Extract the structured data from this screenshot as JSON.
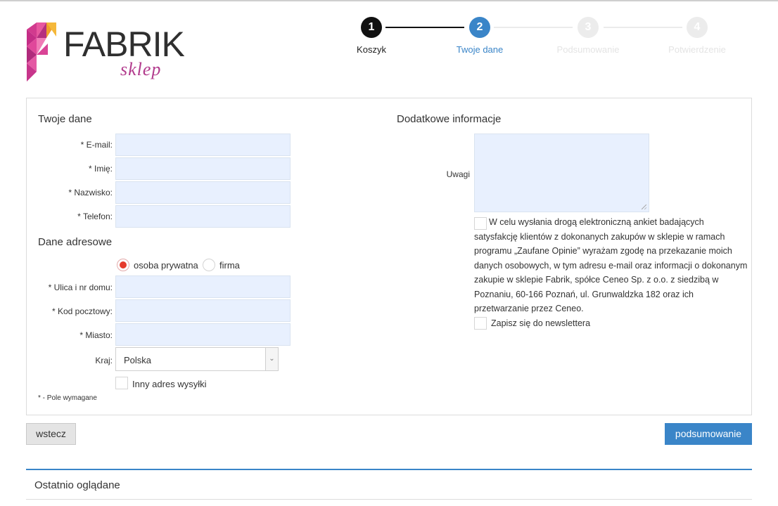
{
  "logo": {
    "brand": "FABRIK",
    "subtitle": "sklep"
  },
  "steps": [
    {
      "number": "1",
      "label": "Koszyk"
    },
    {
      "number": "2",
      "label": "Twoje dane"
    },
    {
      "number": "3",
      "label": "Podsumowanie"
    },
    {
      "number": "4",
      "label": "Potwierdzenie"
    }
  ],
  "personal": {
    "title": "Twoje dane",
    "email_label": "* E-mail:",
    "name_label": "* Imię:",
    "surname_label": "* Nazwisko:",
    "phone_label": "* Telefon:"
  },
  "address": {
    "title": "Dane adresowe",
    "type_private": "osoba prywatna",
    "type_company": "firma",
    "selected_type": "osoba prywatna",
    "street_label": "* Ulica i nr domu:",
    "postcode_label": "* Kod pocztowy:",
    "city_label": "* Miasto:",
    "country_label": "Kraj:",
    "country_value": "Polska",
    "other_shipping_label": "Inny adres wysyłki",
    "required_note": "* - Pole wymagane"
  },
  "additional": {
    "title": "Dodatkowe informacje",
    "notes_label": "Uwagi",
    "consent_text": "W celu wysłania drogą elektroniczną ankiet badających satysfakcję klientów z dokonanych zakupów w sklepie w ramach programu „Zaufane Opinie” wyrażam zgodę na przekazanie moich danych osobowych, w tym adresu e-mail oraz informacji o dokonanym zakupie w sklepie Fabrik, spółce Ceneo Sp. z o.o. z siedzibą w Poznaniu, 60-166 Poznań, ul. Grunwaldzka 182 oraz ich przetwarzanie przez Ceneo.",
    "newsletter_label": "Zapisz się do newslettera"
  },
  "buttons": {
    "back": "wstecz",
    "next": "podsumowanie"
  },
  "recent": {
    "title": "Ostatnio oglądane"
  },
  "colors": {
    "accent": "#3a85c8",
    "radio_selected": "#e53b2d",
    "logo_magenta": "#c0308a",
    "logo_orange": "#f39c2b"
  }
}
